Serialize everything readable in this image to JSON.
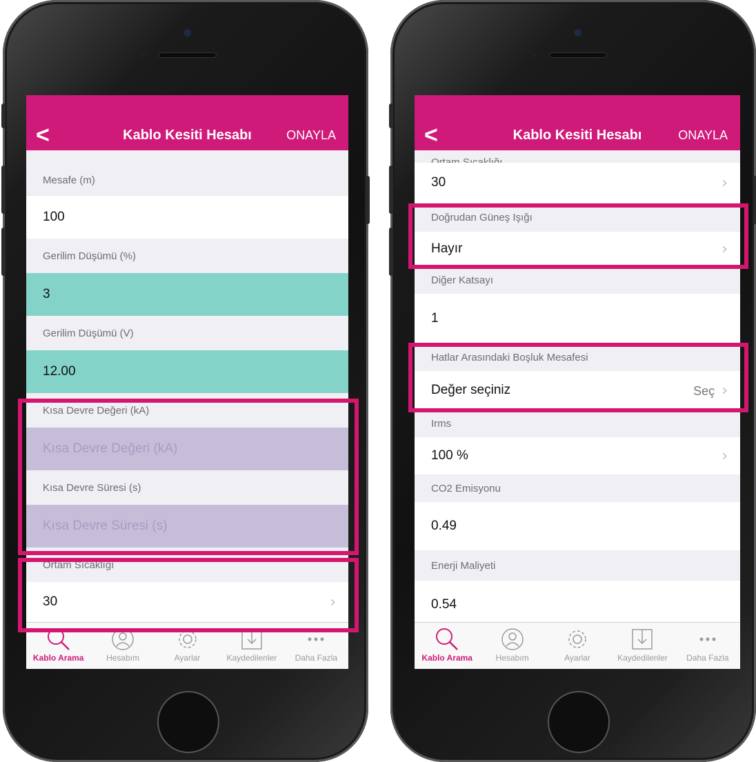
{
  "nav": {
    "back": "<",
    "title": "Kablo Kesiti Hesabı",
    "confirm": "ONAYLA"
  },
  "left": {
    "mesafe_label": "Mesafe (m)",
    "mesafe_value": "100",
    "gerilim_pct_label": "Gerilim Düşümü (%)",
    "gerilim_pct_value": "3",
    "gerilim_v_label": "Gerilim Düşümü (V)",
    "gerilim_v_value": "12.00",
    "kisa_deger_label": "Kısa Devre Değeri (kA)",
    "kisa_deger_placeholder": "Kısa Devre Değeri (kA)",
    "kisa_sure_label": "Kısa Devre Süresi (s)",
    "kisa_sure_placeholder": "Kısa Devre Süresi (s)",
    "ortam_label": "Ortam Sıcaklığı",
    "ortam_value": "30"
  },
  "right": {
    "ortam_label": "Ortam Sıcaklığı",
    "ortam_value": "30",
    "gunes_label": "Doğrudan Güneş Işığı",
    "gunes_value": "Hayır",
    "diger_label": "Diğer Katsayı",
    "diger_value": "1",
    "bosluk_label": "Hatlar Arasındaki Boşluk Mesafesi",
    "bosluk_value": "Değer seçiniz",
    "bosluk_action": "Seç",
    "irms_label": "Irms",
    "irms_value": "100 %",
    "co2_label": "CO2 Emisyonu",
    "co2_value": "0.49",
    "enerji_label": "Enerji Maliyeti",
    "enerji_value": "0.54"
  },
  "tabs": [
    {
      "label": "Kablo Arama",
      "icon": "search-icon",
      "active": true
    },
    {
      "label": "Hesabım",
      "icon": "user-icon",
      "active": false
    },
    {
      "label": "Ayarlar",
      "icon": "gear-icon",
      "active": false
    },
    {
      "label": "Kaydedilenler",
      "icon": "download-icon",
      "active": false
    },
    {
      "label": "Daha Fazla",
      "icon": "more-icon",
      "active": false
    }
  ],
  "colors": {
    "accent": "#d01a79",
    "teal": "#84d3c8",
    "lavender": "#c6bed8",
    "highlight": "#d4166f"
  }
}
